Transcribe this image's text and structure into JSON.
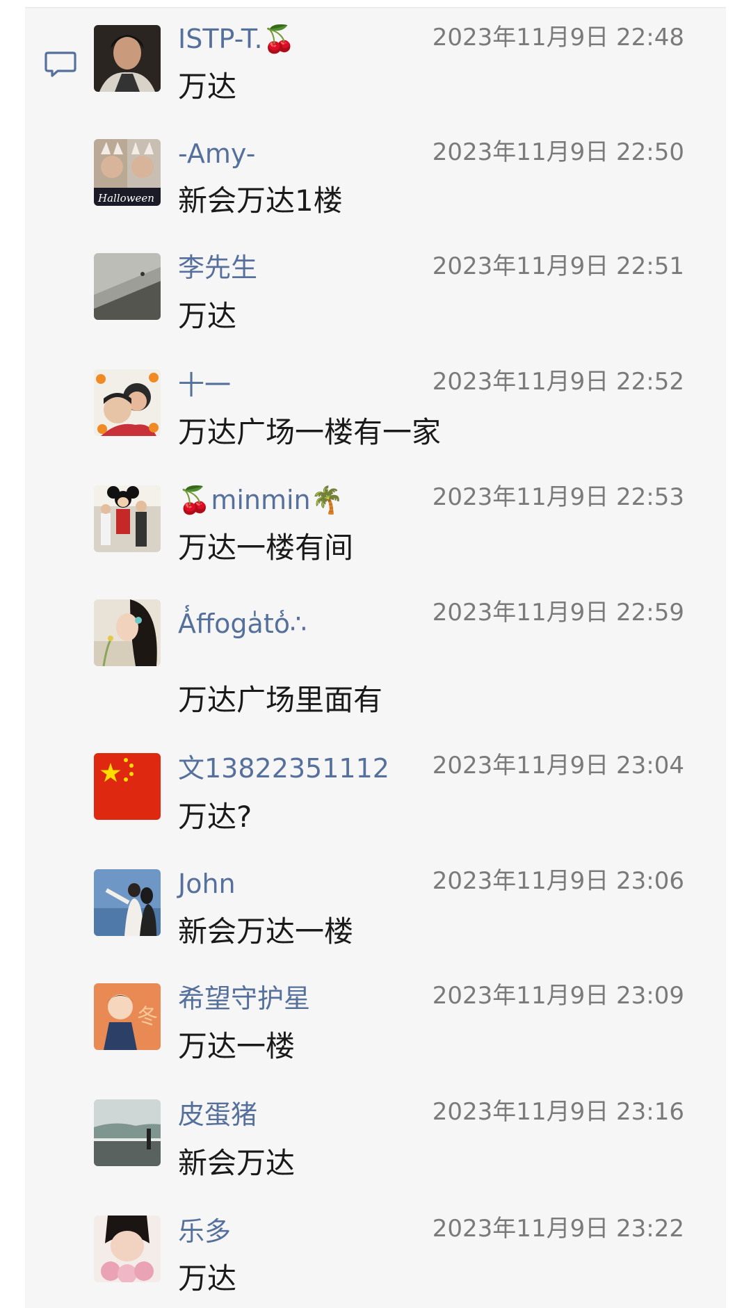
{
  "comment_icon": "comment-bubble-icon",
  "messages": [
    {
      "name": "ISTP-T.🍒",
      "time": "2023年11月9日 22:48",
      "text": "万达",
      "avatar": "avatar-photo-man"
    },
    {
      "name": "-Amy-",
      "time": "2023年11月9日 22:50",
      "text": "新会万达1楼",
      "avatar": "avatar-halloween"
    },
    {
      "name": "李先生",
      "time": "2023年11月9日 22:51",
      "text": "万达",
      "avatar": "avatar-stairs"
    },
    {
      "name": "十一",
      "time": "2023年11月9日 22:52",
      "text": "万达广场一楼有一家",
      "avatar": "avatar-family-halloween"
    },
    {
      "name": "🍒minmin🌴",
      "time": "2023年11月9日 22:53",
      "text": "万达一楼有间",
      "avatar": "avatar-mickey"
    },
    {
      "name": "A̾ffoga̍to̾∴",
      "time": "2023年11月9日 22:59",
      "text": "万达广场里面有",
      "avatar": "avatar-girl-hair"
    },
    {
      "name": "文13822351112",
      "time": "2023年11月9日 23:04",
      "text": "万达?",
      "avatar": "avatar-china-flag"
    },
    {
      "name": "John",
      "time": "2023年11月9日 23:06",
      "text": "新会万达一楼",
      "avatar": "avatar-couple-sea"
    },
    {
      "name": "希望守护星",
      "time": "2023年11月9日 23:09",
      "text": "万达一楼",
      "avatar": "avatar-cartoon-kid"
    },
    {
      "name": "皮蛋猪",
      "time": "2023年11月9日 23:16",
      "text": "新会万达",
      "avatar": "avatar-seaside"
    },
    {
      "name": "乐多",
      "time": "2023年11月9日 23:22",
      "text": "万达",
      "avatar": "avatar-baby-flowers"
    }
  ]
}
